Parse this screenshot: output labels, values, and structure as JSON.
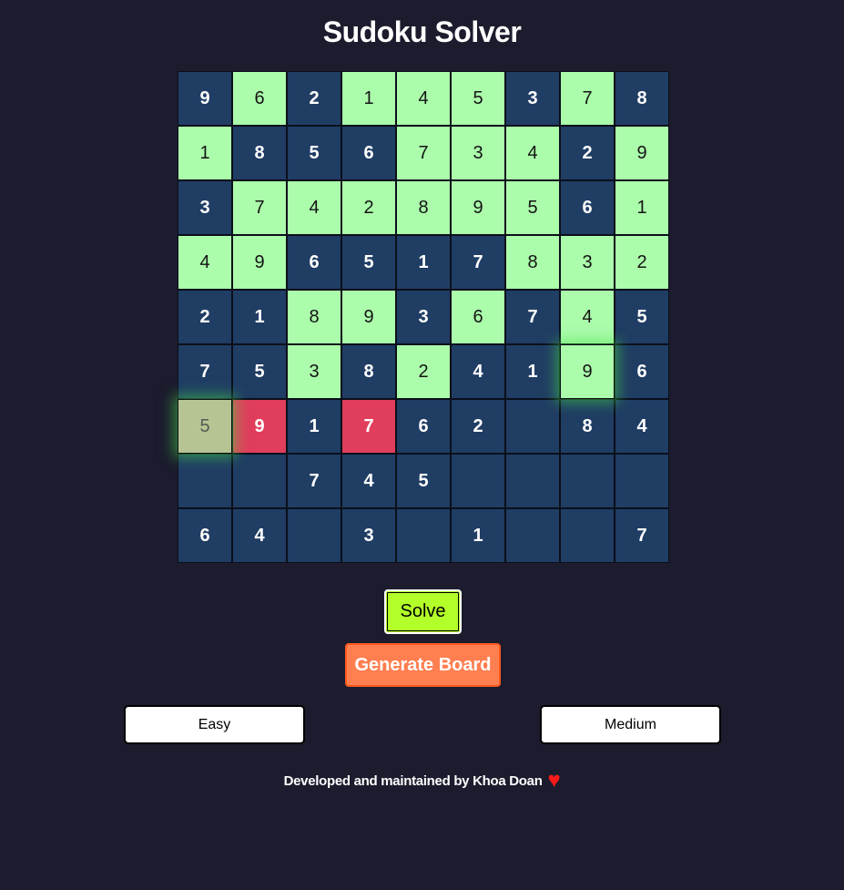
{
  "app": {
    "title": "Sudoku Solver"
  },
  "board": {
    "rows": [
      [
        {
          "v": "9",
          "s": "blue"
        },
        {
          "v": "6",
          "s": "green"
        },
        {
          "v": "2",
          "s": "blue"
        },
        {
          "v": "1",
          "s": "green"
        },
        {
          "v": "4",
          "s": "green"
        },
        {
          "v": "5",
          "s": "green"
        },
        {
          "v": "3",
          "s": "blue"
        },
        {
          "v": "7",
          "s": "green"
        },
        {
          "v": "8",
          "s": "blue"
        }
      ],
      [
        {
          "v": "1",
          "s": "green"
        },
        {
          "v": "8",
          "s": "blue"
        },
        {
          "v": "5",
          "s": "blue"
        },
        {
          "v": "6",
          "s": "blue"
        },
        {
          "v": "7",
          "s": "green"
        },
        {
          "v": "3",
          "s": "green"
        },
        {
          "v": "4",
          "s": "green"
        },
        {
          "v": "2",
          "s": "blue"
        },
        {
          "v": "9",
          "s": "green"
        }
      ],
      [
        {
          "v": "3",
          "s": "blue"
        },
        {
          "v": "7",
          "s": "green"
        },
        {
          "v": "4",
          "s": "green"
        },
        {
          "v": "2",
          "s": "green"
        },
        {
          "v": "8",
          "s": "green"
        },
        {
          "v": "9",
          "s": "green"
        },
        {
          "v": "5",
          "s": "green"
        },
        {
          "v": "6",
          "s": "blue"
        },
        {
          "v": "1",
          "s": "green"
        }
      ],
      [
        {
          "v": "4",
          "s": "green"
        },
        {
          "v": "9",
          "s": "green"
        },
        {
          "v": "6",
          "s": "blue"
        },
        {
          "v": "5",
          "s": "blue"
        },
        {
          "v": "1",
          "s": "blue"
        },
        {
          "v": "7",
          "s": "blue"
        },
        {
          "v": "8",
          "s": "green"
        },
        {
          "v": "3",
          "s": "green"
        },
        {
          "v": "2",
          "s": "green"
        }
      ],
      [
        {
          "v": "2",
          "s": "blue"
        },
        {
          "v": "1",
          "s": "blue"
        },
        {
          "v": "8",
          "s": "green"
        },
        {
          "v": "9",
          "s": "green"
        },
        {
          "v": "3",
          "s": "blue"
        },
        {
          "v": "6",
          "s": "green"
        },
        {
          "v": "7",
          "s": "blue"
        },
        {
          "v": "4",
          "s": "green"
        },
        {
          "v": "5",
          "s": "blue"
        }
      ],
      [
        {
          "v": "7",
          "s": "blue"
        },
        {
          "v": "5",
          "s": "blue"
        },
        {
          "v": "3",
          "s": "green"
        },
        {
          "v": "8",
          "s": "blue"
        },
        {
          "v": "2",
          "s": "green"
        },
        {
          "v": "4",
          "s": "blue"
        },
        {
          "v": "1",
          "s": "blue"
        },
        {
          "v": "9",
          "s": "green",
          "glow": true
        },
        {
          "v": "6",
          "s": "blue"
        }
      ],
      [
        {
          "v": "5",
          "s": "candidate",
          "glow": true
        },
        {
          "v": "9",
          "s": "red"
        },
        {
          "v": "1",
          "s": "blue"
        },
        {
          "v": "7",
          "s": "red"
        },
        {
          "v": "6",
          "s": "blue"
        },
        {
          "v": "2",
          "s": "blue"
        },
        {
          "v": "",
          "s": "blue"
        },
        {
          "v": "8",
          "s": "blue"
        },
        {
          "v": "4",
          "s": "blue"
        }
      ],
      [
        {
          "v": "",
          "s": "blue"
        },
        {
          "v": "",
          "s": "blue"
        },
        {
          "v": "7",
          "s": "blue"
        },
        {
          "v": "4",
          "s": "blue"
        },
        {
          "v": "5",
          "s": "blue"
        },
        {
          "v": "",
          "s": "blue"
        },
        {
          "v": "",
          "s": "blue"
        },
        {
          "v": "",
          "s": "blue"
        },
        {
          "v": "",
          "s": "blue"
        }
      ],
      [
        {
          "v": "6",
          "s": "blue"
        },
        {
          "v": "4",
          "s": "blue"
        },
        {
          "v": "",
          "s": "blue"
        },
        {
          "v": "3",
          "s": "blue"
        },
        {
          "v": "",
          "s": "blue"
        },
        {
          "v": "1",
          "s": "blue"
        },
        {
          "v": "",
          "s": "blue"
        },
        {
          "v": "",
          "s": "blue"
        },
        {
          "v": "7",
          "s": "blue"
        }
      ]
    ]
  },
  "controls": {
    "solve_label": "Solve",
    "generate_label": "Generate Board",
    "easy_label": "Easy",
    "medium_label": "Medium"
  },
  "footer": {
    "text": "Developed and maintained by Khoa Doan",
    "heart": "♥"
  },
  "colors": {
    "background": "#1c1c2e",
    "cell_given": "#203d64",
    "cell_solved": "#abfcab",
    "cell_conflict": "#e13e5c",
    "cell_current": "#b6c493",
    "solve_button": "#b3ff29",
    "generate_button": "#ff7f50",
    "heart": "#ff1a1a"
  }
}
